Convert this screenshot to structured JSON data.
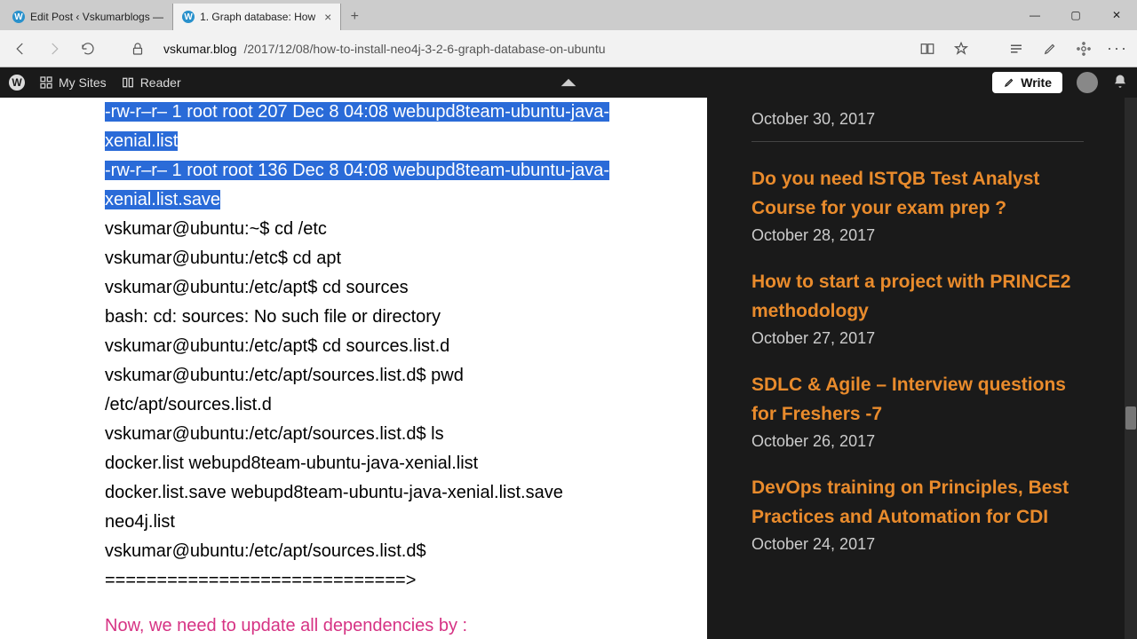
{
  "window": {
    "tabs": [
      {
        "favicon": "W",
        "label": "Edit Post ‹ Vskumarblogs —",
        "active": false
      },
      {
        "favicon": "W",
        "label": "1. Graph database: How",
        "active": true
      }
    ],
    "url_host": "vskumar.blog",
    "url_path": "/2017/12/08/how-to-install-neo4j-3-2-6-graph-database-on-ubuntu"
  },
  "wpbar": {
    "mysites": "My Sites",
    "reader": "Reader",
    "write": "Write"
  },
  "article": {
    "hl1": "-rw-r–r– 1 root root 207 Dec 8 04:08 webupd8team-ubuntu-java-xenial.list",
    "hl2": "-rw-r–r– 1 root root 136 Dec 8 04:08 webupd8team-ubuntu-java-xenial.list.save",
    "lines": [
      "vskumar@ubuntu:~$ cd /etc",
      "vskumar@ubuntu:/etc$ cd apt",
      "vskumar@ubuntu:/etc/apt$ cd sources",
      "bash: cd: sources: No such file or directory",
      "vskumar@ubuntu:/etc/apt$ cd sources.list.d",
      "vskumar@ubuntu:/etc/apt/sources.list.d$ pwd",
      "/etc/apt/sources.list.d",
      "vskumar@ubuntu:/etc/apt/sources.list.d$ ls",
      "docker.list webupd8team-ubuntu-java-xenial.list",
      "docker.list.save webupd8team-ubuntu-java-xenial.list.save",
      "neo4j.list",
      "vskumar@ubuntu:/etc/apt/sources.list.d$",
      "=============================>"
    ],
    "pink": "Now, we need to update all dependencies by :"
  },
  "sidebar": {
    "date0": "October 30, 2017",
    "posts": [
      {
        "title": "Do you need ISTQB Test Analyst Course for your exam prep ?",
        "date": "October 28, 2017"
      },
      {
        "title": "How to start a project with PRINCE2 methodology",
        "date": "October 27, 2017"
      },
      {
        "title": "SDLC & Agile – Interview questions for Freshers -7",
        "date": "October 26, 2017"
      },
      {
        "title": "DevOps training on Principles, Best Practices and Automation for CDI",
        "date": "October 24, 2017"
      }
    ]
  }
}
